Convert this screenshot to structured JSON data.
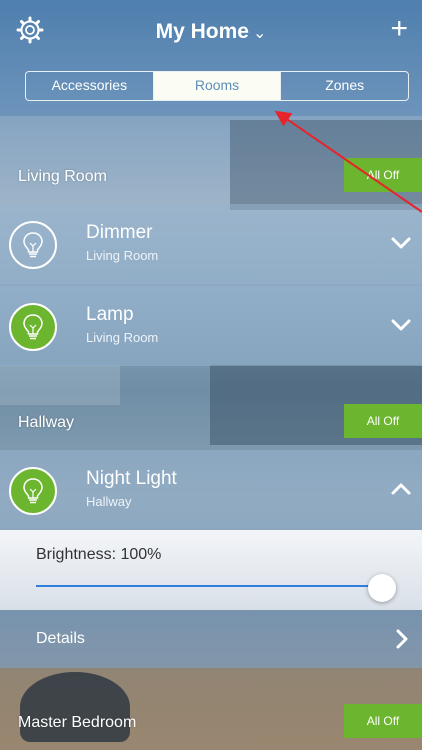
{
  "header": {
    "title": "My Home",
    "title_chevron": "⌄",
    "add_label": "+",
    "settings_icon": "gear-icon"
  },
  "tabs": [
    {
      "label": "Accessories",
      "active": false
    },
    {
      "label": "Rooms",
      "active": true
    },
    {
      "label": "Zones",
      "active": false
    }
  ],
  "rooms": [
    {
      "name": "Living Room",
      "all_off_label": "All Off",
      "accessories": [
        {
          "name": "Dimmer",
          "room": "Living Room",
          "on": false,
          "expanded": false
        },
        {
          "name": "Lamp",
          "room": "Living Room",
          "on": true,
          "expanded": false
        }
      ]
    },
    {
      "name": "Hallway",
      "all_off_label": "All Off",
      "accessories": [
        {
          "name": "Night Light",
          "room": "Hallway",
          "on": true,
          "expanded": true
        }
      ]
    },
    {
      "name": "Master Bedroom",
      "all_off_label": "All Off",
      "accessories": []
    }
  ],
  "night_light_panel": {
    "brightness_label": "Brightness: 100%",
    "brightness": 100,
    "details_label": "Details"
  },
  "colors": {
    "accent_green": "#6cb52e",
    "slider_blue": "#2f7fe0",
    "annotation_red": "#e8232b"
  }
}
